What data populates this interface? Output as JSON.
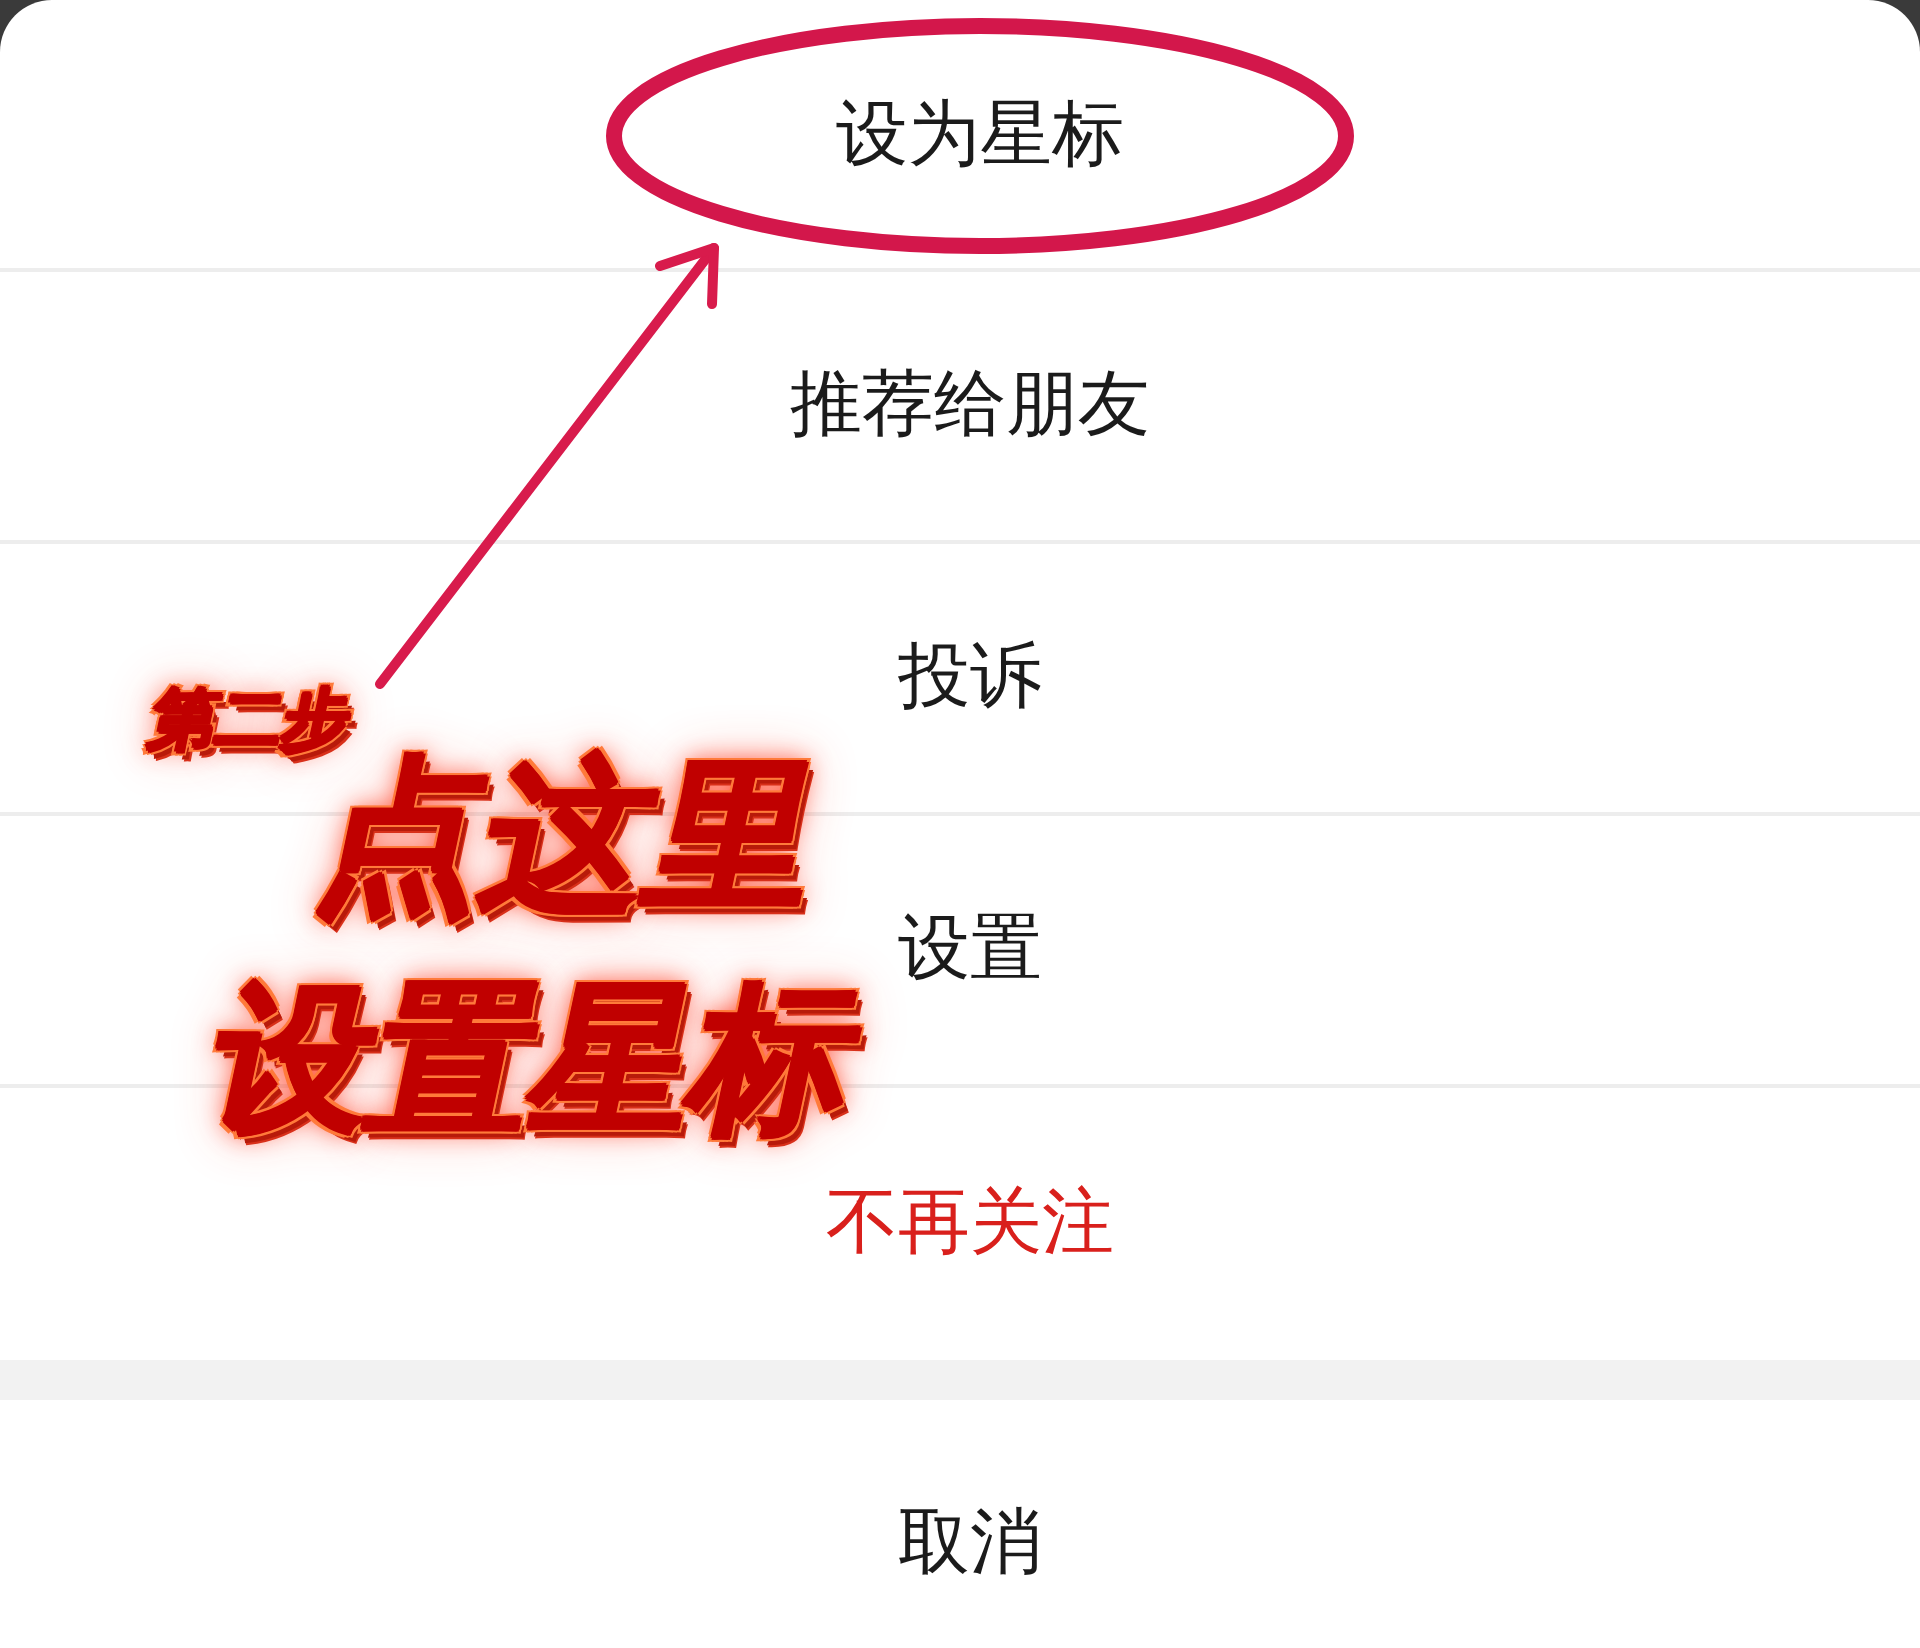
{
  "menu": {
    "items": [
      {
        "label": "设为星标",
        "kind": "normal",
        "highlighted": true
      },
      {
        "label": "推荐给朋友",
        "kind": "normal",
        "highlighted": false
      },
      {
        "label": "投诉",
        "kind": "normal",
        "highlighted": false
      },
      {
        "label": "设置",
        "kind": "normal",
        "highlighted": false
      },
      {
        "label": "不再关注",
        "kind": "destructive",
        "highlighted": false
      }
    ]
  },
  "cancel_button": {
    "label": "取消"
  },
  "annotation": {
    "step_label": "第二步",
    "callout_lines": [
      "点这里",
      "设置星标"
    ]
  }
}
